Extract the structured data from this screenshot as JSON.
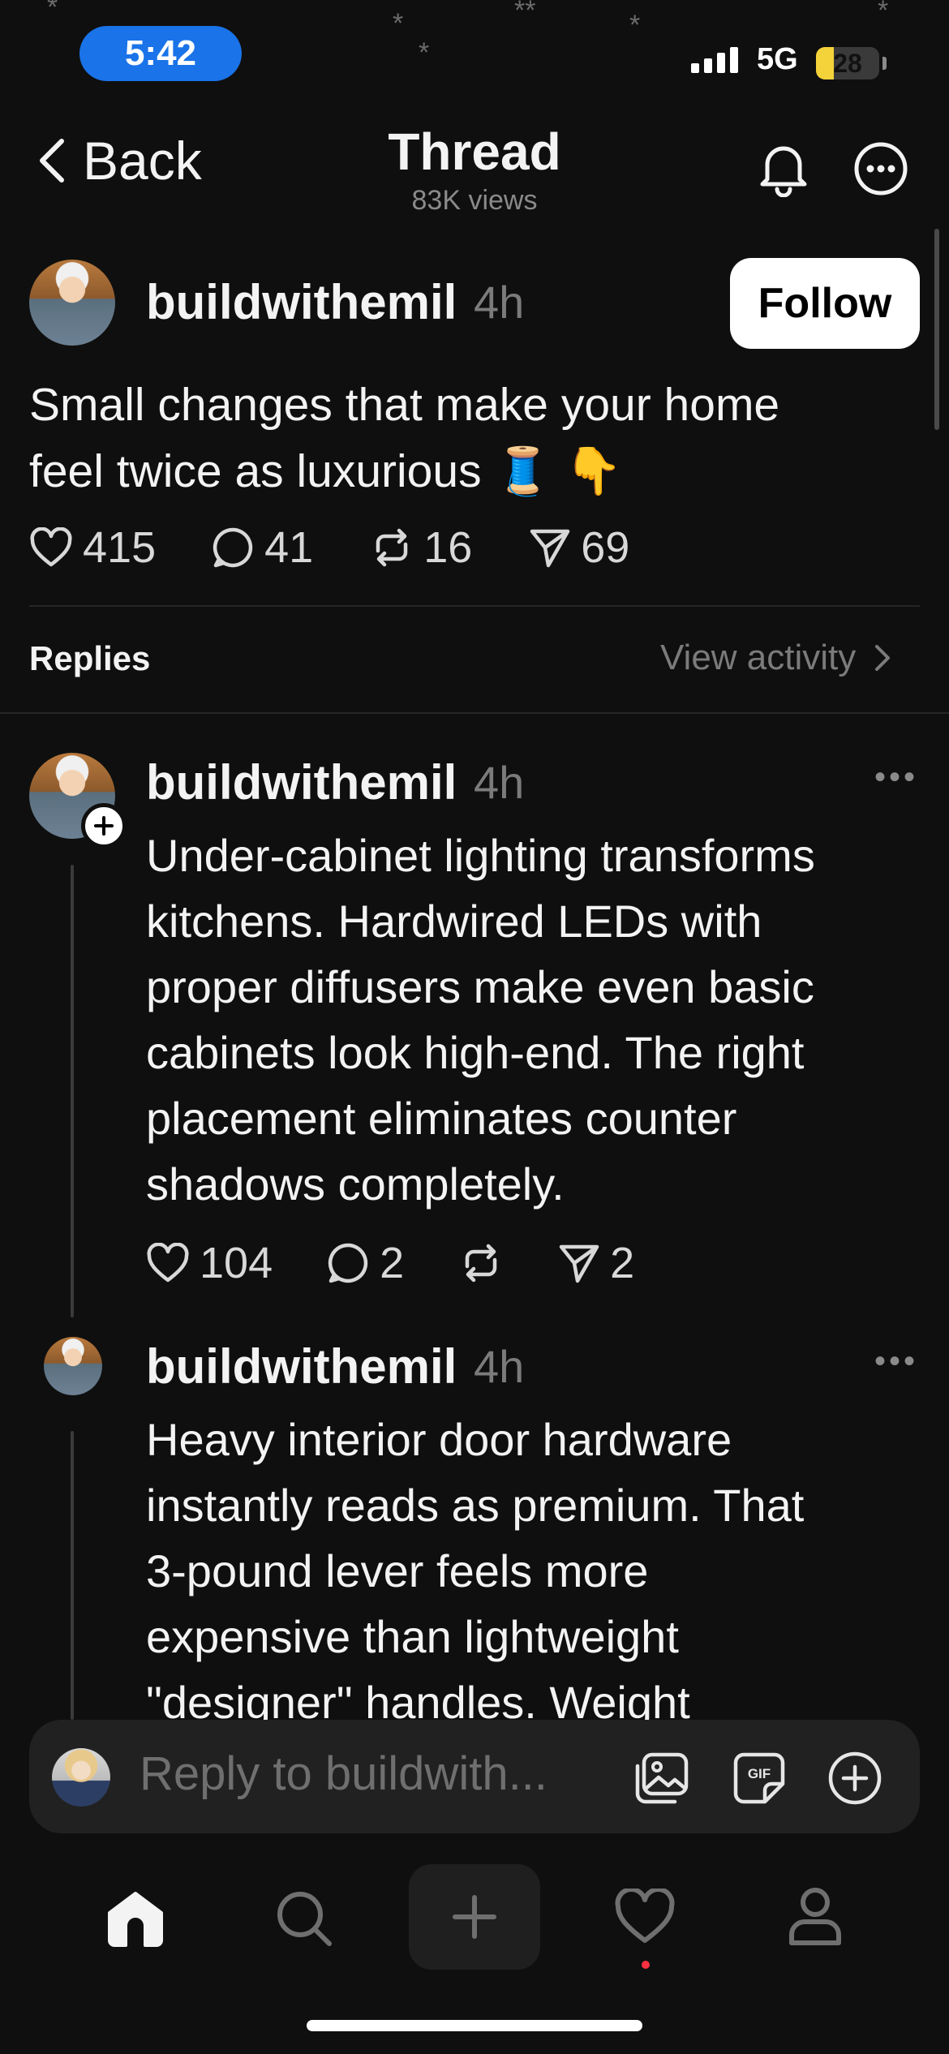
{
  "status_bar": {
    "time": "5:42",
    "network": "5G",
    "battery": "28",
    "battery_level": 0.28,
    "colors": {
      "time_pill": "#1a73e8",
      "battery": "#f4d23a"
    }
  },
  "nav": {
    "back_label": "Back",
    "title": "Thread",
    "views": "83K views",
    "icons": [
      "chevron-left-icon",
      "bell-icon",
      "more-circle-icon"
    ]
  },
  "post": {
    "username": "buildwithemil",
    "time_ago": "4h",
    "follow_label": "Follow",
    "text_line1": "Small changes that make your home",
    "text_line2": "feel twice as luxurious 🧵 👇",
    "likes": "415",
    "comments": "41",
    "reposts": "16",
    "shares": "69"
  },
  "replies_header": {
    "label": "Replies",
    "view_activity": "View activity"
  },
  "replies": [
    {
      "username": "buildwithemil",
      "time_ago": "4h",
      "lines": [
        "Under-cabinet lighting transforms",
        "kitchens. Hardwired LEDs with",
        "proper diffusers make even basic",
        "cabinets look high-end. The right",
        "placement eliminates counter",
        "shadows completely."
      ],
      "likes": "104",
      "comments": "2",
      "shares": "2"
    },
    {
      "username": "buildwithemil",
      "time_ago": "4h",
      "lines": [
        "Heavy interior door hardware",
        "instantly reads as premium. That",
        "3-pound lever feels more",
        "expensive than lightweight",
        "\"designer\" handles. Weight"
      ]
    }
  ],
  "composer": {
    "placeholder": "Reply to buildwith...",
    "gif_label": "GIF"
  },
  "tab_bar": {
    "tabs": [
      "home",
      "search",
      "create",
      "activity",
      "profile"
    ],
    "activity_dot_color": "#ff3040"
  }
}
